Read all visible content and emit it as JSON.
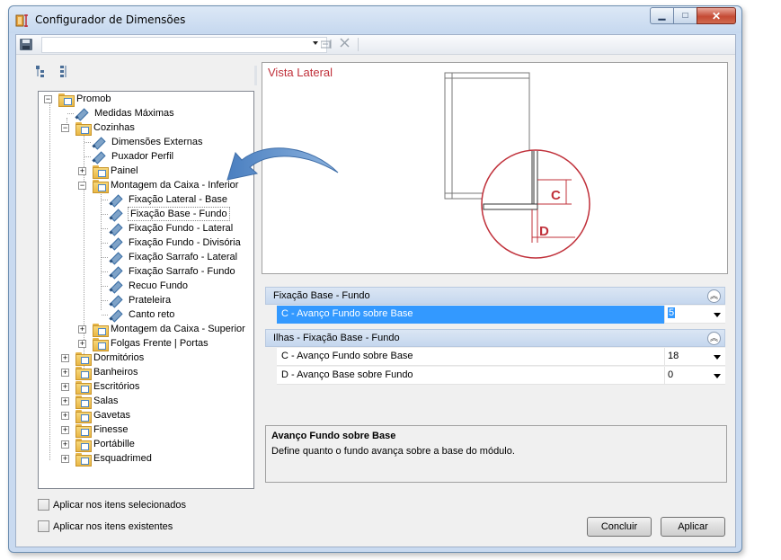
{
  "window": {
    "title": "Configurador de Dimensões",
    "minimize": "▁",
    "maximize": "□",
    "close": "✕"
  },
  "toolbar": {
    "save_icon": "floppy-disk-icon",
    "combo_value": "",
    "icons": [
      "dropdown-arrow-icon",
      "apply-icon",
      "delete-icon"
    ]
  },
  "tree": {
    "nodes": [
      {
        "label": "Promob",
        "type": "folder",
        "expander": "−"
      },
      {
        "label": "Medidas Máximas",
        "type": "item"
      },
      {
        "label": "Cozinhas",
        "type": "folder",
        "expander": "−"
      },
      {
        "label": "Dimensões Externas",
        "type": "item"
      },
      {
        "label": "Puxador Perfil",
        "type": "item"
      },
      {
        "label": "Painel",
        "type": "folder",
        "expander": "+"
      },
      {
        "label": "Montagem da Caixa - Inferior",
        "type": "folder",
        "expander": "−"
      },
      {
        "label": "Fixação Lateral - Base",
        "type": "item"
      },
      {
        "label": "Fixação Base - Fundo",
        "type": "item",
        "selected": true
      },
      {
        "label": "Fixação Fundo - Lateral",
        "type": "item"
      },
      {
        "label": "Fixação Fundo - Divisória",
        "type": "item"
      },
      {
        "label": "Fixação Sarrafo - Lateral",
        "type": "item"
      },
      {
        "label": "Fixação Sarrafo - Fundo",
        "type": "item"
      },
      {
        "label": "Recuo Fundo",
        "type": "item"
      },
      {
        "label": "Prateleira",
        "type": "item"
      },
      {
        "label": "Canto reto",
        "type": "item"
      },
      {
        "label": "Montagem da Caixa - Superior",
        "type": "folder",
        "expander": "+"
      },
      {
        "label": "Folgas Frente | Portas",
        "type": "folder",
        "expander": "+"
      },
      {
        "label": "Dormitórios",
        "type": "folder",
        "expander": "+"
      },
      {
        "label": "Banheiros",
        "type": "folder",
        "expander": "+"
      },
      {
        "label": "Escritórios",
        "type": "folder",
        "expander": "+"
      },
      {
        "label": "Salas",
        "type": "folder",
        "expander": "+"
      },
      {
        "label": "Gavetas",
        "type": "folder",
        "expander": "+"
      },
      {
        "label": "Finesse",
        "type": "folder",
        "expander": "+"
      },
      {
        "label": "Portábille",
        "type": "folder",
        "expander": "+"
      },
      {
        "label": "Esquadrimed",
        "type": "folder",
        "expander": "+"
      }
    ]
  },
  "options": {
    "apply_selected": "Aplicar nos itens selecionados",
    "apply_existing": "Aplicar nos itens existentes"
  },
  "preview": {
    "title": "Vista Lateral",
    "label_c": "C",
    "label_d": "D",
    "accent_color": "#c0303a"
  },
  "properties": {
    "groups": [
      {
        "title": "Fixação Base - Fundo",
        "collapse": "︽",
        "rows": [
          {
            "name": "C - Avanço Fundo sobre Base",
            "value": "5",
            "selected": true
          }
        ]
      },
      {
        "title": "Ilhas - Fixação Base - Fundo",
        "collapse": "︽",
        "rows": [
          {
            "name": "C - Avanço Fundo sobre Base",
            "value": "18"
          },
          {
            "name": "D - Avanço Base sobre Fundo",
            "value": "0"
          }
        ]
      }
    ]
  },
  "description": {
    "title": "Avanço Fundo sobre Base",
    "text": "Define quanto o fundo avança sobre a base do módulo."
  },
  "buttons": {
    "conclude": "Concluir",
    "apply": "Aplicar"
  },
  "colors": {
    "selection": "#3399ff",
    "group_header": "#c5d7ee",
    "arrow": "#5b8fc9"
  }
}
